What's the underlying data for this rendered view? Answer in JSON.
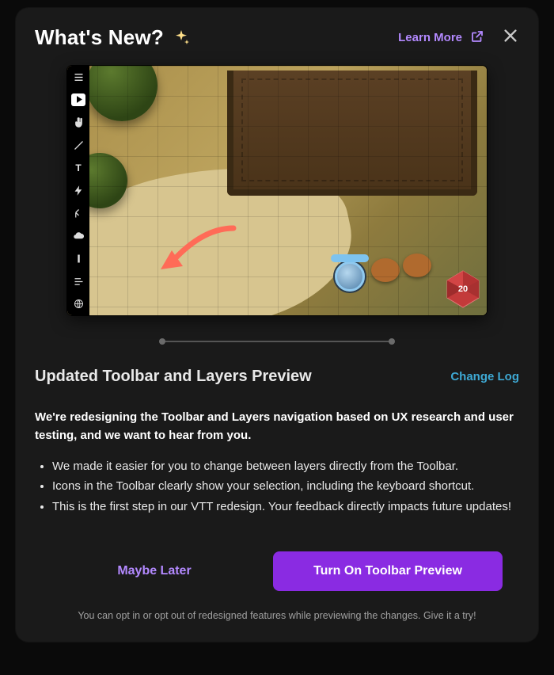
{
  "header": {
    "title": "What's New?",
    "learn_more": "Learn More"
  },
  "preview": {
    "d20_value": "20",
    "toolbar_text_icon": "T"
  },
  "section": {
    "title": "Updated Toolbar and Layers Preview",
    "changelog": "Change Log"
  },
  "intro": "We're redesigning the Toolbar and Layers navigation based on UX research and user testing, and we want to hear from you.",
  "points": [
    "We made it easier for you to change between layers directly from the Toolbar.",
    "Icons in the Toolbar clearly show your selection, including the keyboard shortcut.",
    "This is the first step in our VTT redesign. Your feedback directly impacts future updates!"
  ],
  "actions": {
    "secondary": "Maybe Later",
    "primary": "Turn On Toolbar Preview"
  },
  "footnote": "You can opt in or opt out of redesigned features while previewing the changes. Give it a try!"
}
